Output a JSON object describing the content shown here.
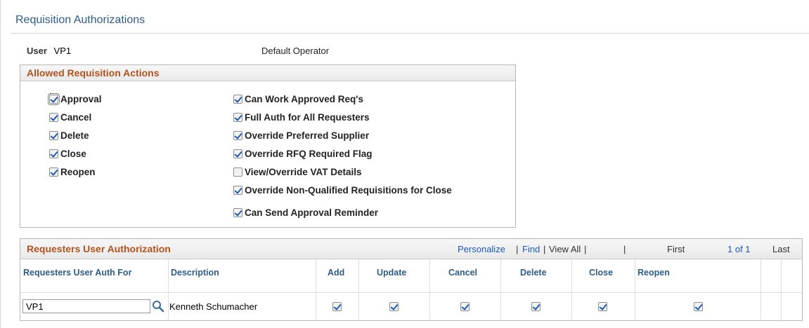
{
  "page": {
    "title": "Requisition Authorizations"
  },
  "user": {
    "label": "User",
    "id": "VP1",
    "description": "Default Operator"
  },
  "actions": {
    "header": "Allowed Requisition Actions",
    "left": [
      {
        "label": "Approval",
        "checked": true
      },
      {
        "label": "Cancel",
        "checked": true
      },
      {
        "label": "Delete",
        "checked": true
      },
      {
        "label": "Close",
        "checked": true
      },
      {
        "label": "Reopen",
        "checked": true
      }
    ],
    "right": [
      {
        "label": "Can Work Approved Req's",
        "checked": true
      },
      {
        "label": "Full Auth for All Requesters",
        "checked": true
      },
      {
        "label": "Override Preferred Supplier",
        "checked": true
      },
      {
        "label": "Override RFQ Required Flag",
        "checked": true
      },
      {
        "label": "View/Override VAT Details",
        "checked": false
      },
      {
        "label": "Override Non-Qualified Requisitions for Close",
        "checked": true
      },
      {
        "label": "Can Send Approval Reminder",
        "checked": true
      }
    ]
  },
  "grid": {
    "title": "Requesters User Authorization",
    "nav": {
      "personalize": "Personalize",
      "find": "Find",
      "view_all": "View All",
      "first": "First",
      "range": "1 of 1",
      "last": "Last"
    },
    "columns": [
      "Requesters User Auth For",
      "Description",
      "Add",
      "Update",
      "Cancel",
      "Delete",
      "Close",
      "Reopen"
    ],
    "rows": [
      {
        "user": "VP1",
        "description": "Kenneth Schumacher",
        "add": true,
        "update": true,
        "cancel": true,
        "delete": true,
        "close": true,
        "reopen": true
      }
    ]
  },
  "colors": {
    "title": "#2b5c8a",
    "section_header": "#b2531d",
    "link": "#1d5bbb"
  },
  "icons": {
    "lookup": "magnifier-icon",
    "checkbox": "checkbox-icon"
  }
}
